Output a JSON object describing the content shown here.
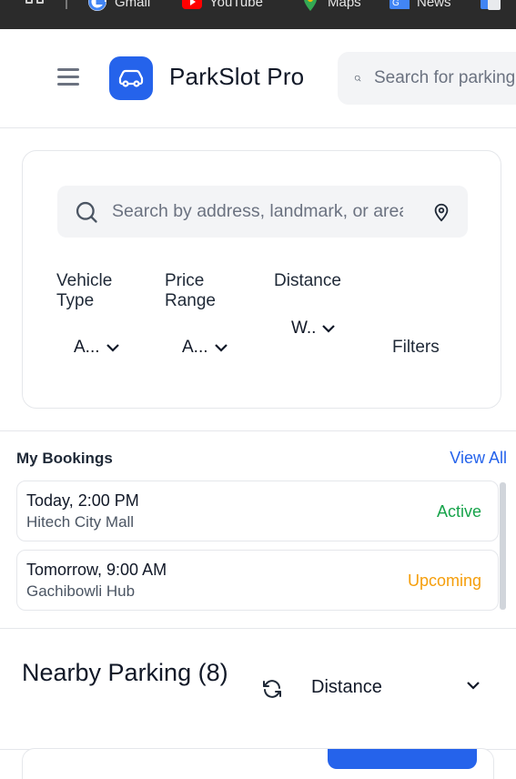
{
  "bookmarks": [
    {
      "label": "Gmail",
      "icon": "google-icon"
    },
    {
      "label": "YouTube",
      "icon": "youtube-icon"
    },
    {
      "label": "Maps",
      "icon": "maps-icon"
    },
    {
      "label": "News",
      "icon": "news-icon"
    }
  ],
  "header": {
    "brand": "ParkSlot Pro",
    "search_placeholder": "Search for parking"
  },
  "filters": {
    "search_placeholder": "Search by address, landmark, or area",
    "vehicle_type": {
      "label": "Vehicle Type",
      "value": "A..."
    },
    "price_range": {
      "label": "Price Range",
      "value": "A..."
    },
    "distance": {
      "label": "Distance",
      "value": "W.."
    },
    "filters_button": "Filters"
  },
  "bookings": {
    "title": "My Bookings",
    "view_all": "View All",
    "items": [
      {
        "when": "Today, 2:00 PM",
        "where": "Hitech City Mall",
        "status": "Active",
        "status_color": "#16a34a"
      },
      {
        "when": "Tomorrow, 9:00 AM",
        "where": "Gachibowli Hub",
        "status": "Upcoming",
        "status_color": "#f59e0b"
      }
    ]
  },
  "nearby": {
    "title": "Nearby Parking (8)",
    "sort_value": "Distance"
  },
  "colors": {
    "accent": "#2563eb",
    "active": "#16a34a",
    "upcoming": "#f59e0b"
  }
}
